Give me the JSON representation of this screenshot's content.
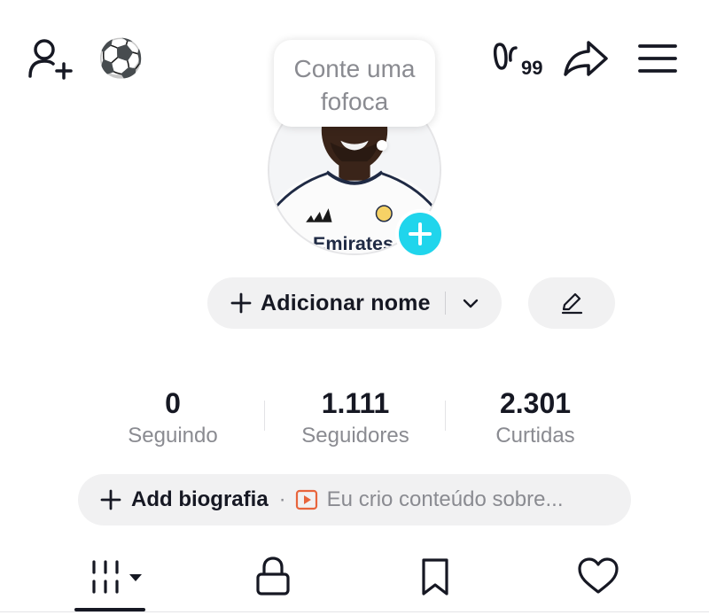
{
  "header": {
    "add_friend_icon": "person-plus-icon",
    "soccer_icon": "soccer-ball-icon",
    "soccer_glyph": "⚽",
    "visitors_icon": "footprints-icon",
    "visitors_count": "99",
    "share_icon": "share-arrow-icon",
    "menu_icon": "hamburger-menu-icon"
  },
  "tooltip": {
    "line1": "Conte uma",
    "line2": "fofoca"
  },
  "profile": {
    "avatar_icon": "avatar-photo",
    "add_photo_icon": "plus-circle-icon",
    "add_name_label": "Adicionar nome",
    "dropdown_icon": "chevron-down-icon",
    "edit_icon": "pencil-icon"
  },
  "stats": [
    {
      "value": "0",
      "label": "Seguindo"
    },
    {
      "value": "1.111",
      "label": "Seguidores"
    },
    {
      "value": "2.301",
      "label": "Curtidas"
    }
  ],
  "bio": {
    "add_label": "Add biografia",
    "separator": "·",
    "suggestion": "Eu crio conteúdo sobre..."
  },
  "tabs": [
    {
      "name": "videos-grid",
      "icon": "grid-icon"
    },
    {
      "name": "private",
      "icon": "lock-icon"
    },
    {
      "name": "saved",
      "icon": "bookmark-icon"
    },
    {
      "name": "liked",
      "icon": "heart-icon"
    }
  ],
  "colors": {
    "accent": "#20d5ec",
    "text": "#161823",
    "muted": "#8a8b91",
    "pill_bg": "#f1f1f2",
    "play_icon": "#e8653c"
  }
}
